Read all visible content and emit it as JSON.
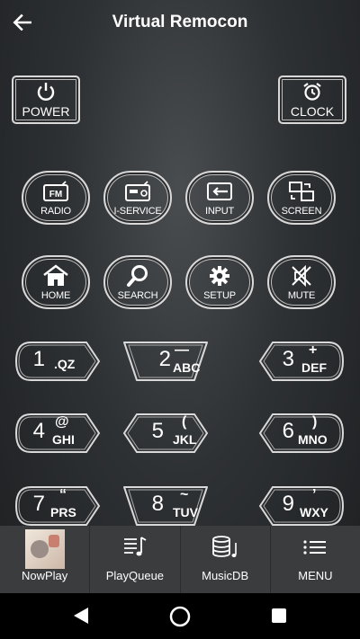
{
  "header": {
    "title": "Virtual Remocon"
  },
  "top_buttons": {
    "power": "POWER",
    "clock": "CLOCK"
  },
  "row1": [
    "RADIO",
    "I-SERVICE",
    "INPUT",
    "SCREEN"
  ],
  "row2": [
    "HOME",
    "SEARCH",
    "SETUP",
    "MUTE"
  ],
  "keypad": [
    {
      "digit": "1",
      "symbol": "",
      "letters": ".QZ"
    },
    {
      "digit": "2",
      "symbol": "—",
      "letters": "ABC"
    },
    {
      "digit": "3",
      "symbol": "+",
      "letters": "DEF"
    },
    {
      "digit": "4",
      "symbol": "@",
      "letters": "GHI"
    },
    {
      "digit": "5",
      "symbol": "(",
      "letters": "JKL"
    },
    {
      "digit": "6",
      "symbol": ")",
      "letters": "MNO"
    },
    {
      "digit": "7",
      "symbol": "“",
      "letters": "PRS"
    },
    {
      "digit": "8",
      "symbol": "~",
      "letters": "TUV"
    },
    {
      "digit": "9",
      "symbol": "’",
      "letters": "WXY"
    }
  ],
  "bottom_tabs": [
    "NowPlay",
    "PlayQueue",
    "MusicDB",
    "MENU"
  ],
  "colors": {
    "background": "#2e3134",
    "button_border": "#d9d9d9",
    "tab_bar": "#3a3c3e"
  }
}
